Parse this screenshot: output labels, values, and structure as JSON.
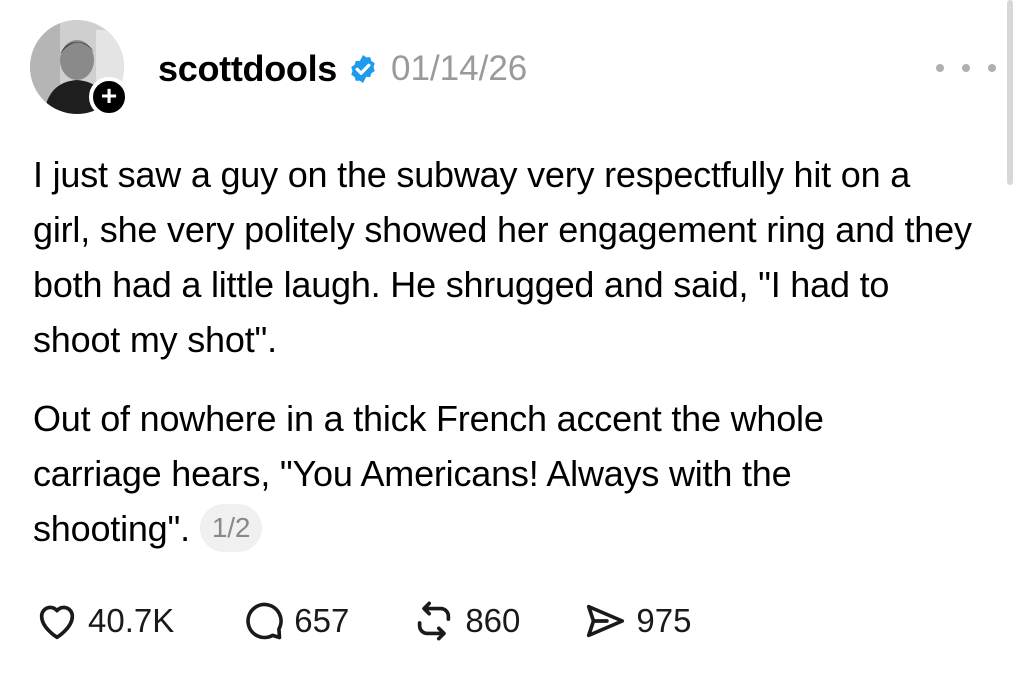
{
  "post": {
    "username": "scottdools",
    "date": "01/14/26",
    "verified_icon": "verified-badge-icon",
    "follow_icon": "plus-icon",
    "follow_symbol": "+",
    "more_icon": "ellipsis-icon",
    "paragraphs": [
      "I just saw a guy on the subway very respectfully hit on a girl, she very politely showed her engagement ring and they both had a little laugh. He shrugged and said, \"I had to shoot my shot\".",
      "Out of nowhere in a thick French accent the whole carriage hears, \"You Americans! Always with the shooting\"."
    ],
    "page_indicator": "1/2"
  },
  "actions": {
    "like": {
      "icon": "heart-icon",
      "count": "40.7K"
    },
    "reply": {
      "icon": "speech-bubble-icon",
      "count": "657"
    },
    "repost": {
      "icon": "repost-icon",
      "count": "860"
    },
    "share": {
      "icon": "send-icon",
      "count": "975"
    }
  },
  "colors": {
    "text": "#000000",
    "muted": "#9a9a9a",
    "verified_blue": "#1d9bf0",
    "pill_bg": "#f0f0f0"
  }
}
